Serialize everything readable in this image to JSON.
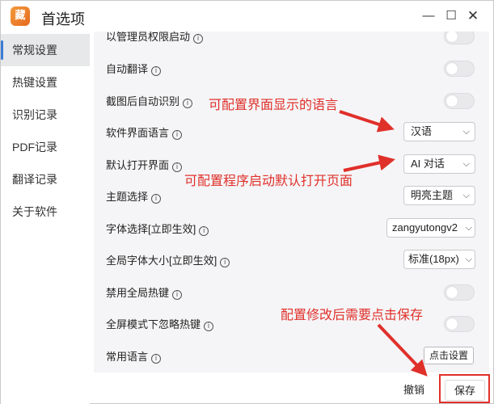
{
  "window": {
    "title": "首选项",
    "app_icon_glyph": "藏"
  },
  "sidebar": {
    "items": [
      {
        "label": "常规设置",
        "active": true
      },
      {
        "label": "热键设置"
      },
      {
        "label": "识别记录"
      },
      {
        "label": "PDF记录"
      },
      {
        "label": "翻译记录"
      },
      {
        "label": "关于软件"
      }
    ]
  },
  "settings": {
    "partial_top_label": "以管理员权限启动",
    "rows": [
      {
        "label": "自动翻译",
        "control": "toggle",
        "on": false
      },
      {
        "label": "截图后自动识别",
        "control": "toggle",
        "on": false
      },
      {
        "label": "软件界面语言",
        "control": "select",
        "value": "汉语"
      },
      {
        "label": "默认打开界面",
        "control": "select",
        "value": "AI 对话"
      },
      {
        "label": "主题选择",
        "control": "select",
        "value": "明亮主题"
      },
      {
        "label": "字体选择[立即生效]",
        "control": "select",
        "value": "zangyutongv2"
      },
      {
        "label": "全局字体大小[立即生效]",
        "control": "select",
        "value": "标准(18px)"
      },
      {
        "label": "禁用全局热键",
        "control": "toggle",
        "on": false
      },
      {
        "label": "全屏模式下忽略热键",
        "control": "toggle",
        "on": false
      },
      {
        "label": "常用语言",
        "control": "button",
        "value": "点击设置"
      }
    ]
  },
  "footer": {
    "cancel_label": "撤销",
    "save_label": "保存"
  },
  "annotations": {
    "ui_language": "可配置界面显示的语言",
    "default_page": "可配置程序启动默认打开页面",
    "save_hint": "配置修改后需要点击保存"
  },
  "icons": {
    "info": "info-circle-icon",
    "chevron": "chevron-down-icon"
  },
  "colors": {
    "annotation_red": "#e0302a",
    "sidebar_active": "#e7e8ea",
    "content_bg": "#f5f5f7"
  }
}
